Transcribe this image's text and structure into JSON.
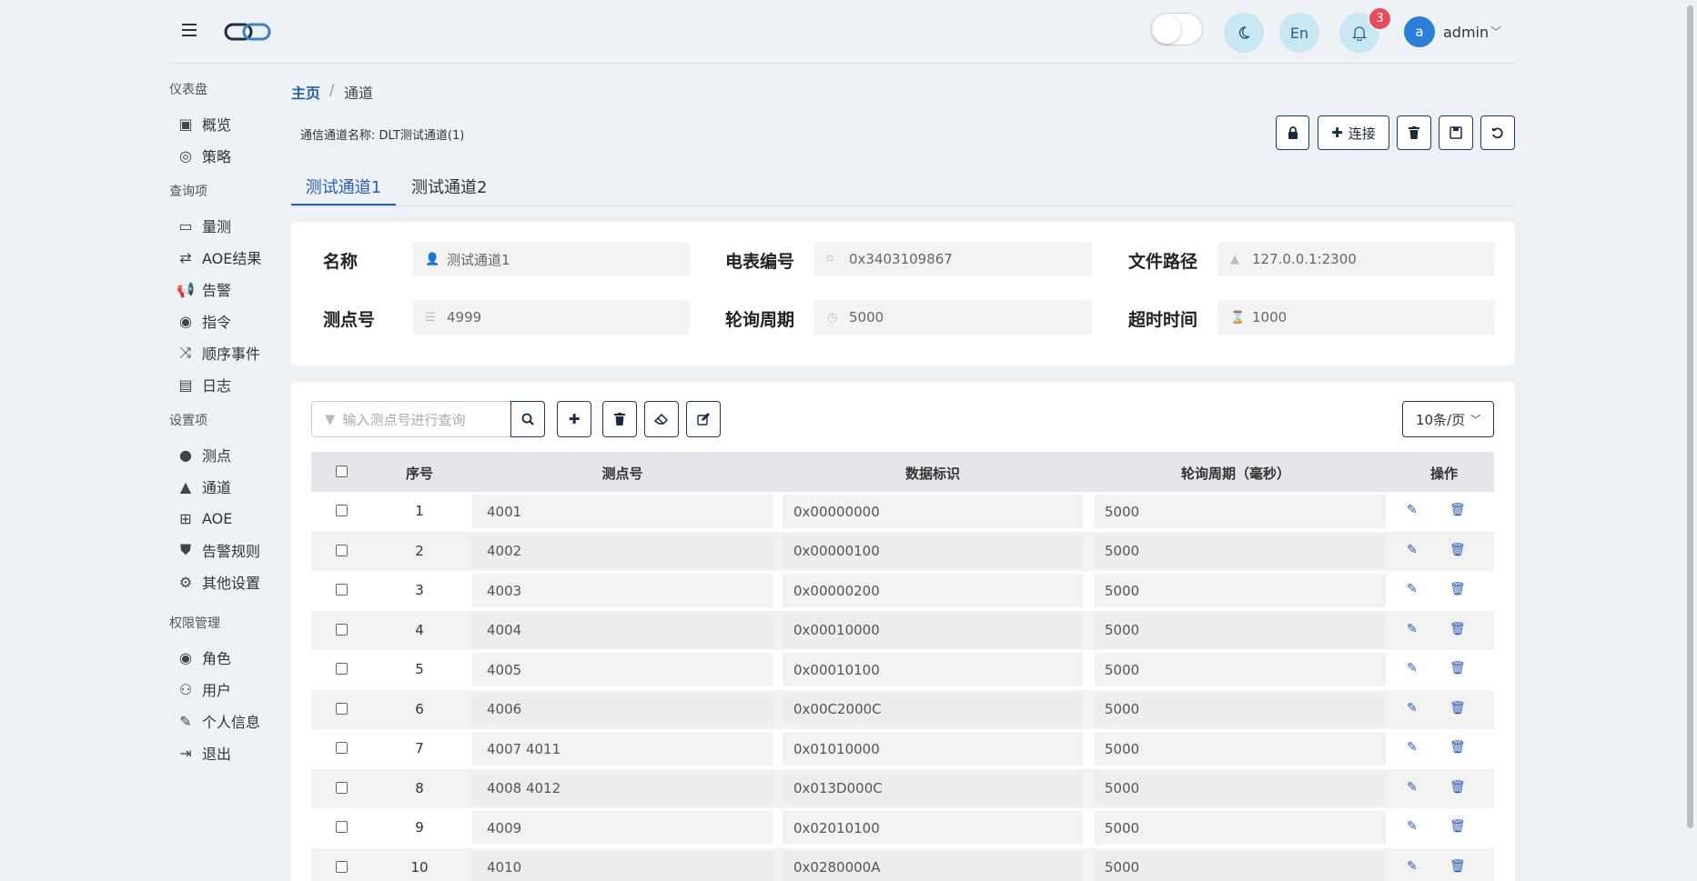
{
  "header": {
    "lang_label": "En",
    "notif_count": "3",
    "avatar_letter": "a",
    "user_name": "admin"
  },
  "sidebar": [
    {
      "section": "仪表盘",
      "items": [
        {
          "label": "概览",
          "icon": "dashboard-icon"
        },
        {
          "label": "策略",
          "icon": "compass-icon"
        }
      ]
    },
    {
      "section": "查询项",
      "items": [
        {
          "label": "量测",
          "icon": "monitor-icon"
        },
        {
          "label": "AOE结果",
          "icon": "retweet-icon"
        },
        {
          "label": "告警",
          "icon": "bullhorn-icon"
        },
        {
          "label": "指令",
          "icon": "podcast-icon"
        },
        {
          "label": "顺序事件",
          "icon": "random-icon"
        },
        {
          "label": "日志",
          "icon": "book-icon"
        }
      ]
    },
    {
      "section": "设置项",
      "items": [
        {
          "label": "测点",
          "icon": "pin-icon"
        },
        {
          "label": "通道",
          "icon": "road-icon"
        },
        {
          "label": "AOE",
          "icon": "sitemap-icon"
        },
        {
          "label": "告警规则",
          "icon": "shield-icon"
        },
        {
          "label": "其他设置",
          "icon": "cogs-icon"
        }
      ]
    },
    {
      "section": "权限管理",
      "items": [
        {
          "label": "角色",
          "icon": "user-circle-icon"
        },
        {
          "label": "用户",
          "icon": "users-icon"
        },
        {
          "label": "个人信息",
          "icon": "edit-icon"
        },
        {
          "label": "退出",
          "icon": "sign-out-icon"
        }
      ]
    }
  ],
  "breadcrumb": {
    "home": "主页",
    "separator": "/",
    "current": "通道"
  },
  "channel_name_label": "通信通道名称: DLT测试通道(1)",
  "toolbar": {
    "connect_label": "连接"
  },
  "tabs": [
    "测试通道1",
    "测试通道2"
  ],
  "form": {
    "name_label": "名称",
    "name_value": "测试通道1",
    "meter_label": "电表编号",
    "meter_value": "0x3403109867",
    "path_label": "文件路径",
    "path_value": "127.0.0.1:2300",
    "points_label": "测点号",
    "points_value": "4999",
    "poll_label": "轮询周期",
    "poll_value": "5000",
    "timeout_label": "超时时间",
    "timeout_value": "1000"
  },
  "search": {
    "placeholder": "输入测点号进行查询"
  },
  "per_page": "10条/页",
  "table": {
    "headers": [
      "序号",
      "测点号",
      "数据标识",
      "轮询周期（毫秒）",
      "操作"
    ],
    "rows": [
      {
        "idx": "1",
        "point": "4001",
        "data_id": "0x00000000",
        "period": "5000"
      },
      {
        "idx": "2",
        "point": "4002",
        "data_id": "0x00000100",
        "period": "5000"
      },
      {
        "idx": "3",
        "point": "4003",
        "data_id": "0x00000200",
        "period": "5000"
      },
      {
        "idx": "4",
        "point": "4004",
        "data_id": "0x00010000",
        "period": "5000"
      },
      {
        "idx": "5",
        "point": "4005",
        "data_id": "0x00010100",
        "period": "5000"
      },
      {
        "idx": "6",
        "point": "4006",
        "data_id": "0x00C2000C",
        "period": "5000"
      },
      {
        "idx": "7",
        "point": "4007  4011",
        "data_id": "0x01010000",
        "period": "5000"
      },
      {
        "idx": "8",
        "point": "4008  4012",
        "data_id": "0x013D000C",
        "period": "5000"
      },
      {
        "idx": "9",
        "point": "4009",
        "data_id": "0x02010100",
        "period": "5000"
      },
      {
        "idx": "10",
        "point": "4010",
        "data_id": "0x0280000A",
        "period": "5000"
      }
    ]
  }
}
